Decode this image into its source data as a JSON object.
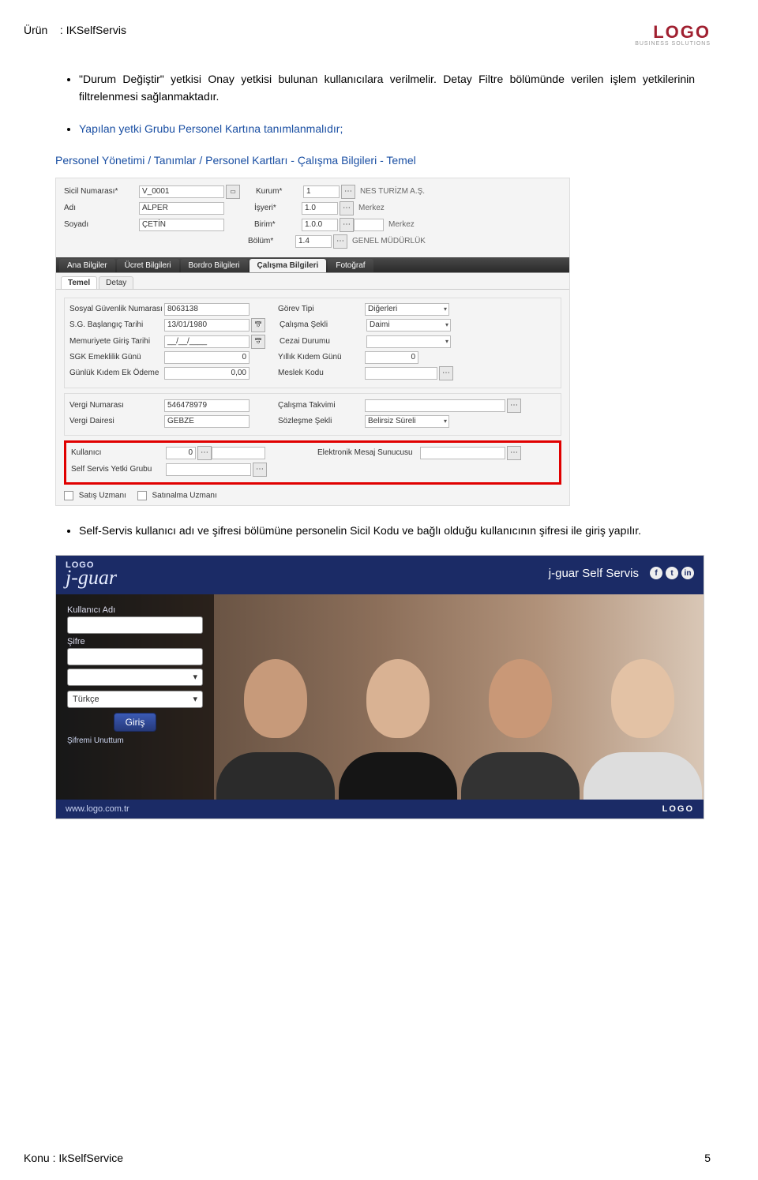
{
  "header": {
    "product_label": "Ürün",
    "product_sep": ":",
    "product_name": "IKSelfServis",
    "logo_text": "LOGO",
    "logo_sub": "BUSINESS SOLUTIONS"
  },
  "bullets": {
    "b1": "\"Durum Değiştir\" yetkisi Onay yetkisi bulunan kullanıcılara verilmelir. Detay Filtre bölümünde verilen işlem yetkilerinin filtrelenmesi sağlanmaktadır.",
    "b2_line1": "Yapılan yetki Grubu Personel Kartına tanımlanmalıdır;",
    "b2_line2": "Personel Yönetimi / Tanımlar / Personel Kartları - Çalışma Bilgileri - Temel",
    "b3": "Self-Servis kullanıcı adı ve şifresi bölümüne personelin Sicil Kodu ve bağlı olduğu kullanıcının şifresi ile giriş yapılır."
  },
  "pform": {
    "labels": {
      "sicil": "Sicil Numarası*",
      "adi": "Adı",
      "soyadi": "Soyadı",
      "kurum": "Kurum*",
      "isyeri": "İşyeri*",
      "birim": "Birim*",
      "bolum": "Bölüm*"
    },
    "values": {
      "sicil": "V_0001",
      "adi": "ALPER",
      "soyadi": "ÇETİN",
      "kurum_code": "1",
      "kurum_desc": "NES TURİZM A.Ş.",
      "isyeri_code": "1.0",
      "isyeri_desc": "Merkez",
      "birim_code": "1.0.0",
      "birim_desc": "Merkez",
      "bolum_code": "1.4",
      "bolum_desc": "GENEL MÜDÜRLÜK"
    },
    "tabs": [
      "Ana Bilgiler",
      "Ücret Bilgileri",
      "Bordro Bilgileri",
      "Çalışma Bilgileri",
      "Fotoğraf"
    ],
    "active_tab": "Çalışma Bilgileri",
    "subtabs": [
      "Temel",
      "Detay"
    ],
    "active_subtab": "Temel",
    "s1": {
      "sgn_l": "Sosyal Güvenlik Numarası",
      "sgn_v": "8063138",
      "sgb_l": "S.G. Başlangıç Tarihi",
      "sgb_v": "13/01/1980",
      "mgt_l": "Memuriyete Giriş Tarihi",
      "mgt_v": "__/__/____",
      "seg_l": "SGK Emeklilik Günü",
      "seg_v": "0",
      "gke_l": "Günlük Kıdem Ek Ödeme",
      "gke_v": "0,00",
      "gt_l": "Görev Tipi",
      "gt_v": "Diğerleri",
      "cs_l": "Çalışma Şekli",
      "cs_v": "Daimi",
      "cd_l": "Cezai Durumu",
      "cd_v": "",
      "ykg_l": "Yıllık Kıdem Günü",
      "ykg_v": "0",
      "mk_l": "Meslek Kodu",
      "mk_v": ""
    },
    "s2": {
      "vn_l": "Vergi Numarası",
      "vn_v": "546478979",
      "vd_l": "Vergi Dairesi",
      "vd_v": "GEBZE",
      "ct_l": "Çalışma Takvimi",
      "ct_v": "",
      "ss_l": "Sözleşme Şekli",
      "ss_v": "Belirsiz Süreli"
    },
    "s3": {
      "ku_l": "Kullanıcı",
      "ku_v": "0",
      "ssyg_l": "Self Servis Yetki Grubu",
      "ems_l": "Elektronik Mesaj Sunucusu"
    },
    "chk1": "Satış Uzmanı",
    "chk2": "Satınalma Uzmanı"
  },
  "login": {
    "brand_small": "LOGO",
    "brand_script": "j-guar",
    "title_right": "j-guar Self Servis",
    "username_l": "Kullanıcı Adı",
    "password_l": "Şifre",
    "lang": "Türkçe",
    "btn": "Giriş",
    "forgot": "Şifremi Unuttum",
    "footer_url": "www.logo.com.tr",
    "footer_logo": "LOGO"
  },
  "footer": {
    "konu_l": "Konu :",
    "konu_v": "IkSelfService",
    "page": "5"
  }
}
